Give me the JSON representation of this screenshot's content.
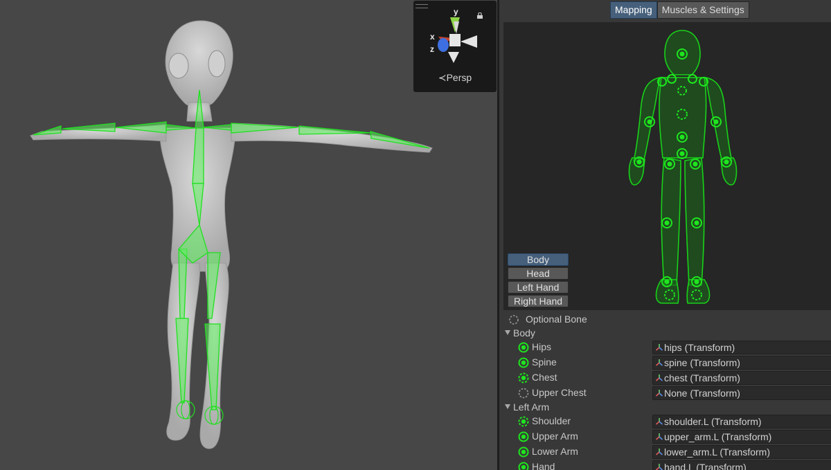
{
  "scene": {
    "gizmo": {
      "axis_y": "y",
      "axis_x": "x",
      "axis_z": "z",
      "projection": "Persp",
      "icons": [
        "lock-icon",
        "perspective-icon"
      ]
    }
  },
  "inspector": {
    "tabs": [
      {
        "label": "Mapping",
        "active": true
      },
      {
        "label": "Muscles & Settings",
        "active": false
      }
    ],
    "view_buttons": [
      {
        "label": "Body",
        "active": true
      },
      {
        "label": "Head",
        "active": false
      },
      {
        "label": "Left Hand",
        "active": false
      },
      {
        "label": "Right Hand",
        "active": false
      }
    ],
    "legend": {
      "optional_bone": "Optional Bone"
    },
    "sections": [
      {
        "title": "Body",
        "bones": [
          {
            "name": "Hips",
            "value": "hips (Transform)",
            "optional": false
          },
          {
            "name": "Spine",
            "value": "spine (Transform)",
            "optional": false
          },
          {
            "name": "Chest",
            "value": "chest (Transform)",
            "optional": true
          },
          {
            "name": "Upper Chest",
            "value": "None (Transform)",
            "optional": true,
            "unassigned": true
          }
        ]
      },
      {
        "title": "Left Arm",
        "bones": [
          {
            "name": "Shoulder",
            "value": "shoulder.L (Transform)",
            "optional": true
          },
          {
            "name": "Upper Arm",
            "value": "upper_arm.L (Transform)",
            "optional": false
          },
          {
            "name": "Lower Arm",
            "value": "lower_arm.L (Transform)",
            "optional": false
          },
          {
            "name": "Hand",
            "value": "hand.L (Transform)",
            "optional": false
          }
        ]
      }
    ]
  },
  "colors": {
    "bone_green": "#1cc41c",
    "accent_blue": "#46607c",
    "scene_bg": "#474747",
    "panel_bg": "#383838"
  }
}
